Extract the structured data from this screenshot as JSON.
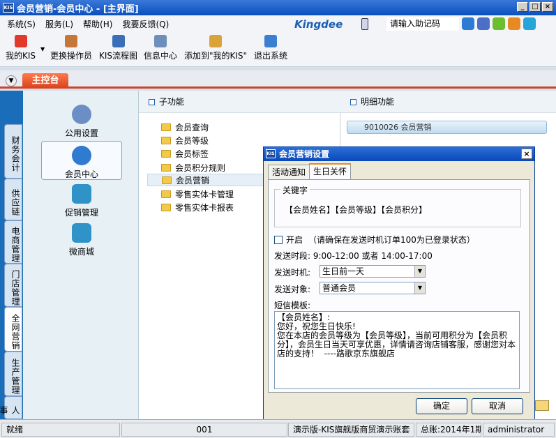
{
  "window": {
    "title": "会员营销-会员中心 - [主界面]",
    "logo": "KIS"
  },
  "menubar": [
    "系统(S)",
    "服务(L)",
    "帮助(H)",
    "我要反馈(Q)"
  ],
  "brand": "Kingdee",
  "helpcode": {
    "placeholder": "请输入助记码"
  },
  "toolbar": [
    "我的KIS",
    "更换操作员",
    "KIS流程图",
    "信息中心",
    "添加到\"我的KIS\"",
    "退出系统"
  ],
  "main_tab": "主控台",
  "left_tabs": [
    "财务会计",
    "供应链",
    "电商管理",
    "门店管理",
    "全网营销",
    "生产管理",
    "人事"
  ],
  "center_items": [
    "公用设置",
    "会员中心",
    "促销管理",
    "微商城"
  ],
  "subfunc": {
    "title": "子功能",
    "items": [
      "会员查询",
      "会员等级",
      "会员标签",
      "会员积分规则",
      "会员营销",
      "零售实体卡管理",
      "零售实体卡报表"
    ]
  },
  "detail": {
    "title": "明细功能",
    "item": "9010026   会员营销"
  },
  "status": {
    "ready": "就绪",
    "code": "001",
    "account": "演示版-KIS旗舰版商贸演示账套",
    "period": "总账:2014年1期",
    "user": "administrator"
  },
  "dialog": {
    "title": "会员营销设置",
    "tabs": [
      "活动通知",
      "生日关怀"
    ],
    "keyword_label": "关键字",
    "keywords": "【会员姓名】【会员等级】【会员积分】",
    "enable_label": "开启",
    "enable_note": "（请确保在发送时机订单100为已登录状态）",
    "send_period": "发送时段: 9:00-12:00 或者 14:00-17:00",
    "send_time_label": "发送时机:",
    "send_time_value": "生日前一天",
    "send_target_label": "发送对象:",
    "send_target_value": "普通会员",
    "sms_label": "短信模板:",
    "sms_text": "【会员姓名】:\n您好，祝您生日快乐!\n您在本店的会员等级为【会员等级】，当前可用积分为【会员积分】，会员生日当天可享优惠，详情请咨询店铺客服，感谢您对本店的支持！  ----路歌京东旗舰店",
    "ok": "确定",
    "cancel": "取消"
  },
  "colors": {
    "titlebar": "#0a4fc0",
    "accent": "#d8401c",
    "nav": "#1a6db8"
  }
}
